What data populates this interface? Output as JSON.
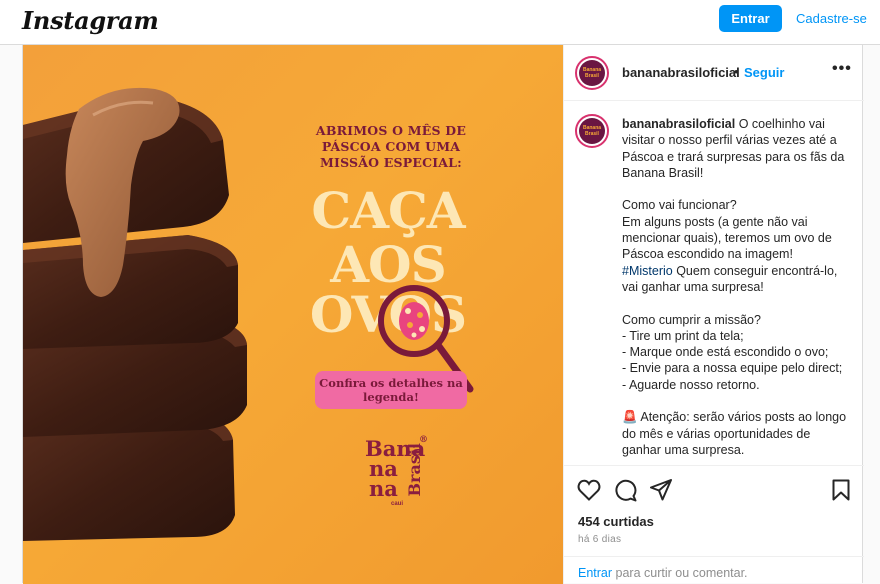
{
  "topbar": {
    "logo": "Instagram",
    "login_label": "Entrar",
    "signup_label": "Cadastre-se"
  },
  "post": {
    "header": {
      "username": "bananabrasiloficial",
      "separator": "•",
      "follow_label": "Seguir",
      "more_icon": "more-horizontal-icon",
      "avatar_text": "Banana Brasil"
    },
    "image": {
      "headline": "ABRIMOS O MÊS DE PÁSCOA COM UMA MISSÃO ESPECIAL:",
      "big_line1": "CAÇA",
      "big_line2": "AOS",
      "big_line3": "OVOS",
      "pill_text": "Confira os detalhes na legenda!",
      "brand_line1": "Bana",
      "brand_line2": "na",
      "brand_line3": "na",
      "brand_word2": "Brasil",
      "brand_small": "caui",
      "brand_registered": "®"
    },
    "caption": {
      "username": "bananabrasiloficial",
      "p1": " O coelhinho vai visitar o nosso perfil várias vezes até a Páscoa e trará surpresas para os fãs da Banana Brasil!",
      "p2": "Como vai funcionar?\nEm alguns posts (a gente não vai mencionar quais), teremos um ovo de Páscoa escondido na imagem!",
      "hashtag": "#Misterio",
      "p2b": " Quem conseguir encontrá-lo, vai ganhar uma surpresa!",
      "p3": "Como cumprir a missão?\n- Tire um print da tela;\n- Marque onde está escondido o ovo;\n- Envie para a nossa equipe pelo direct;\n- Aguarde nosso retorno.",
      "p4_emoji": "🚨",
      "p4": " Atenção: serão vários posts ao longo do mês e várias oportunidades de ganhar uma surpresa."
    },
    "actions": {
      "like_icon": "heart-icon",
      "comment_icon": "comment-icon",
      "share_icon": "send-icon",
      "save_icon": "bookmark-icon",
      "likes_text": "454 curtidas",
      "time_text": "há 6 dias"
    },
    "comment_bar": {
      "login_link": "Entrar",
      "rest": " para curtir ou comentar."
    }
  },
  "colors": {
    "accent": "#0095f6",
    "image_background": "#f6a937",
    "brand_maroon": "#7a1a3a",
    "pill_pink": "#f06aa3"
  }
}
